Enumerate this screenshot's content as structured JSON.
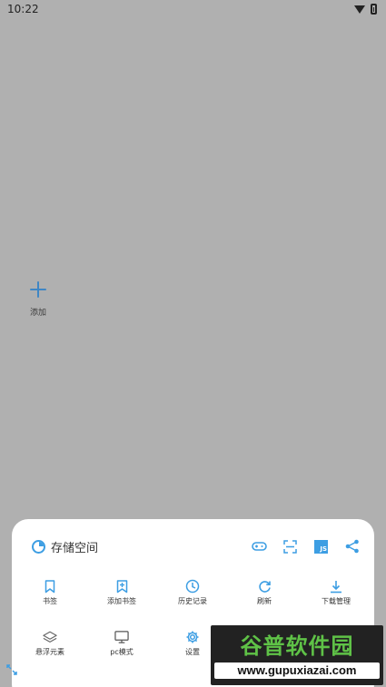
{
  "status_bar": {
    "time": "10:22"
  },
  "home": {
    "add_label": "添加"
  },
  "sheet": {
    "title": "存储空间",
    "header_icons": [
      "gamepad-icon",
      "scan-icon",
      "js-icon",
      "share-icon"
    ],
    "js_badge": "JS",
    "row1": [
      {
        "label": "书签",
        "icon": "bookmark-icon"
      },
      {
        "label": "添加书签",
        "icon": "add-bookmark-icon"
      },
      {
        "label": "历史记录",
        "icon": "history-icon"
      },
      {
        "label": "刷新",
        "icon": "refresh-icon"
      },
      {
        "label": "下载管理",
        "icon": "download-icon"
      }
    ],
    "row2": [
      {
        "label": "悬浮元素",
        "icon": "layers-icon"
      },
      {
        "label": "pc模式",
        "icon": "monitor-icon"
      },
      {
        "label": "设置",
        "icon": "gear-icon"
      }
    ]
  },
  "watermark": {
    "title": "谷普软件园",
    "url": "www.gupuxiazai.com"
  },
  "colors": {
    "accent": "#3d9ee3",
    "background": "#b0b0b0",
    "watermark_green": "#5fc247"
  }
}
